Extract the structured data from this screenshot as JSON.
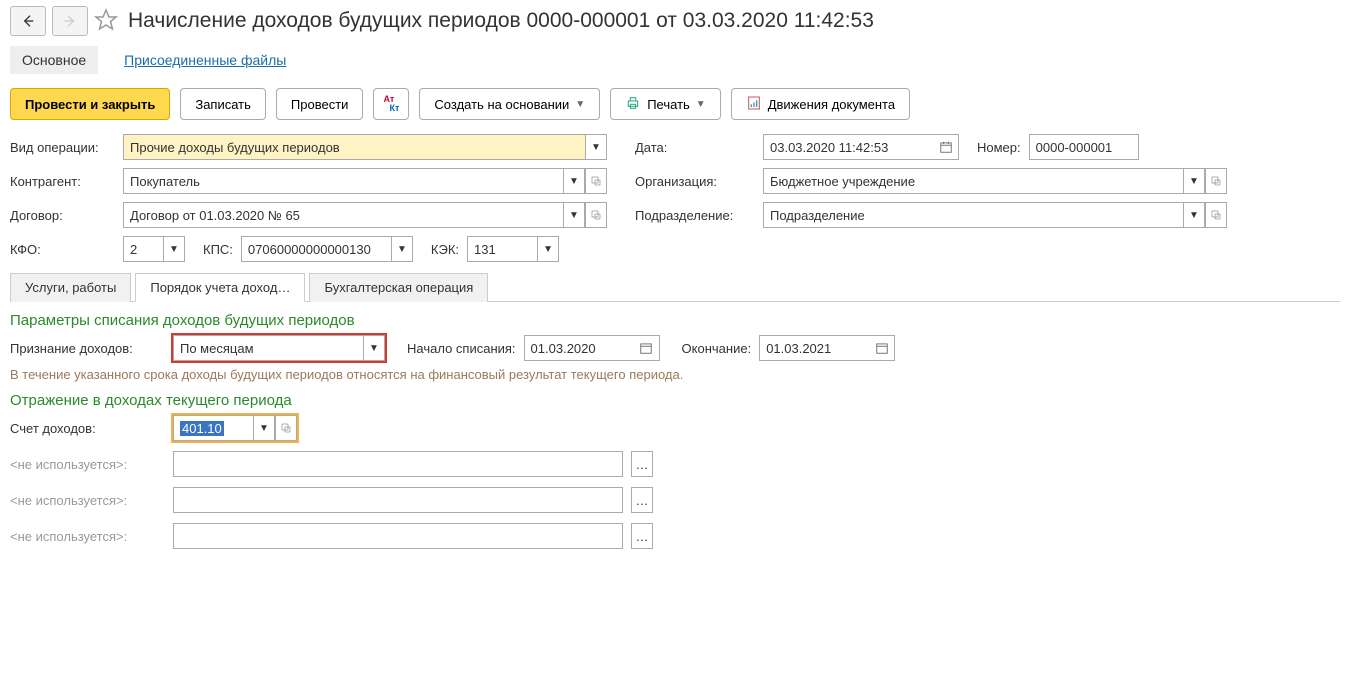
{
  "header": {
    "title": "Начисление доходов будущих периодов 0000-000001 от 03.03.2020 11:42:53"
  },
  "mainTabs": {
    "active": "Основное",
    "link": "Присоединенные файлы"
  },
  "toolbar": {
    "primary": "Провести и закрыть",
    "save": "Записать",
    "post": "Провести",
    "createBased": "Создать на основании",
    "print": "Печать",
    "movements": "Движения документа"
  },
  "form": {
    "opTypeLabel": "Вид операции:",
    "opType": "Прочие доходы будущих периодов",
    "dateLabel": "Дата:",
    "date": "03.03.2020 11:42:53",
    "numberLabel": "Номер:",
    "number": "0000-000001",
    "counterpartyLabel": "Контрагент:",
    "counterparty": "Покупатель",
    "orgLabel": "Организация:",
    "org": "Бюджетное учреждение",
    "contractLabel": "Договор:",
    "contract": "Договор от 01.03.2020 № 65",
    "deptLabel": "Подразделение:",
    "dept": "Подразделение",
    "kfoLabel": "КФО:",
    "kfo": "2",
    "kpsLabel": "КПС:",
    "kps": "07060000000000130",
    "kekLabel": "КЭК:",
    "kek": "131"
  },
  "innerTabs": {
    "t1": "Услуги, работы",
    "t2": "Порядок учета доход…",
    "t3": "Бухгалтерская операция"
  },
  "section1": {
    "title": "Параметры списания доходов будущих периодов",
    "recogLabel": "Признание доходов:",
    "recog": "По месяцам",
    "startLabel": "Начало списания:",
    "start": "01.03.2020",
    "endLabel": "Окончание:",
    "end": "01.03.2021",
    "hint": "В течение указанного срока доходы будущих периодов относятся на финансовый результат текущего периода."
  },
  "section2": {
    "title": "Отражение в доходах текущего периода",
    "acctLabel": "Счет доходов:",
    "acct": "401.10",
    "unused": "<не используется>:"
  }
}
